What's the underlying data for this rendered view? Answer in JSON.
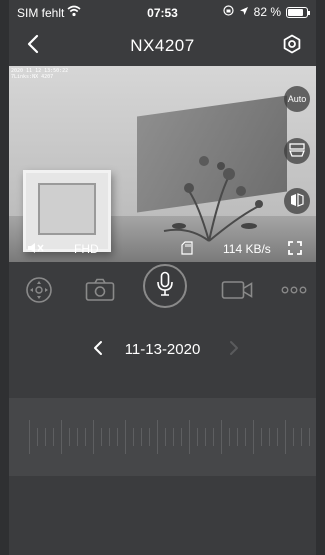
{
  "status": {
    "carrier": "SIM fehlt",
    "time": "07:53",
    "battery_text": "82 %",
    "battery_level": 0.82
  },
  "nav": {
    "title": "NX4207"
  },
  "video": {
    "osd_line1": "2020 11 12 13:50:22",
    "osd_line2": "7Links:NX 4207",
    "auto_label": "Auto",
    "quality": "FHD",
    "bitrate": "114 KB/s"
  },
  "playback": {
    "date": "11-13-2020"
  },
  "icons": {
    "back": "chevron-left-icon",
    "settings": "settings-icon",
    "mute": "speaker-muted-icon",
    "sd": "sd-card-icon",
    "fullscreen": "fullscreen-icon",
    "ptz": "ptz-icon",
    "snapshot": "camera-icon",
    "mic": "microphone-icon",
    "record": "video-record-icon",
    "more": "more-icon"
  }
}
